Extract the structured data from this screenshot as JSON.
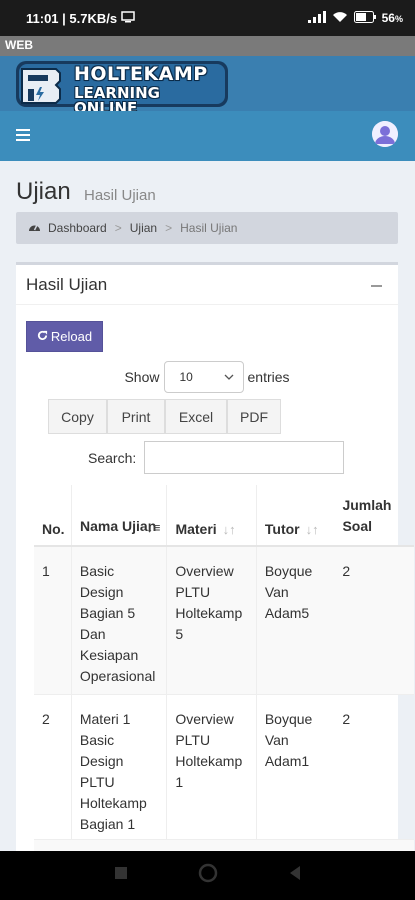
{
  "status_bar": {
    "time_speed": "11:01 | 5.7KB/s",
    "battery": "56"
  },
  "app_label": "WEB",
  "logo": {
    "line1": "HOLTEKAMP",
    "line2": "LEARNING ONLINE"
  },
  "page": {
    "title": "Ujian",
    "subtitle": "Hasil Ujian"
  },
  "breadcrumb": {
    "home": "Dashboard",
    "sep": ">",
    "level2": "Ujian",
    "active": "Hasil Ujian"
  },
  "box": {
    "title": "Hasil Ujian",
    "reload_label": "Reload",
    "show_label": "Show",
    "entries_value": "10",
    "entries_label": "entries",
    "buttons": [
      "Copy",
      "Print",
      "Excel",
      "PDF"
    ],
    "search_label": "Search:"
  },
  "table": {
    "headers": [
      "No.",
      "Nama Ujian",
      "Materi",
      "Tutor",
      "Jumlah Soal"
    ],
    "rows": [
      {
        "no": "1",
        "nama": "Basic Design Bagian 5 Dan Kesiapan Operasional",
        "materi": "Overview PLTU Holtekamp 5",
        "tutor": "Boyque Van Adam5",
        "jumlah": "2"
      },
      {
        "no": "2",
        "nama": "Materi 1 Basic Design PLTU Holtekamp Bagian 1",
        "materi": "Overview PLTU Holtekamp 1",
        "tutor": "Boyque Van Adam1",
        "jumlah": "2"
      }
    ]
  },
  "colors": {
    "navbar": "#3c8dbc",
    "reload_button": "#605ca8"
  }
}
